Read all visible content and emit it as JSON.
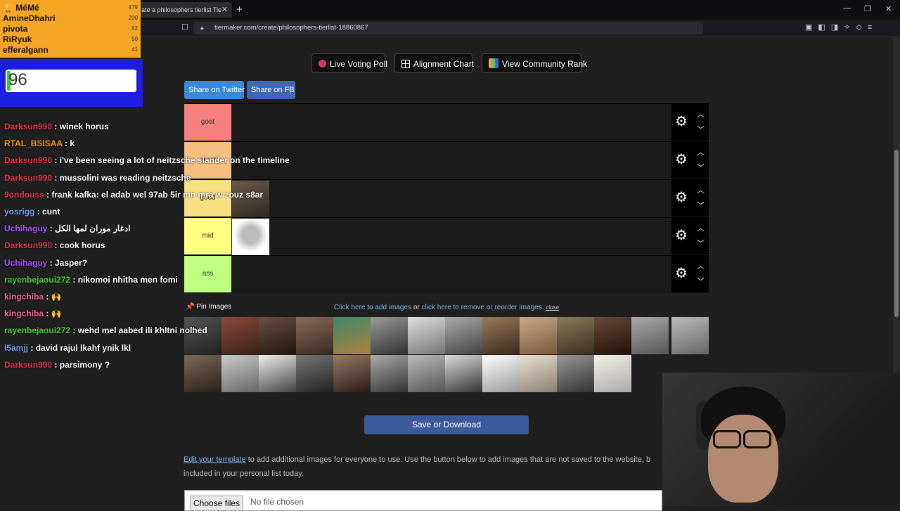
{
  "browser": {
    "tab_title": "ate a philosophers tierlist Tie",
    "tab_close": "✕",
    "new_tab": "+",
    "url": "tiermaker.com/create/philosophers-tierlist-18860867",
    "window_controls": [
      "—",
      "❐",
      "✕"
    ]
  },
  "toolbar": {
    "live_voting": "Live Voting Poll",
    "alignment_chart": "Alignment Chart",
    "community_rank": "View Community Rank",
    "share_twitter": "Share on Twitter",
    "share_fb": "Share on FB"
  },
  "tiers": [
    {
      "label": "goat",
      "color": "#f67f7f"
    },
    {
      "label": "great",
      "color": "#f7bf7f"
    },
    {
      "label": "good",
      "color": "#f7df7f"
    },
    {
      "label": "mid",
      "color": "#ffff80"
    },
    {
      "label": "ass",
      "color": "#bfff7f"
    }
  ],
  "pin": {
    "label": "Pin Images",
    "add_images": "Click here to add images",
    "or": " or ",
    "reorder": "click here to remove or reorder images.",
    "close": "close"
  },
  "save_button": "Save or Download",
  "edit": {
    "link": "Edit your template",
    "text": " to add additional images for everyone to use. Use the button below to add images that are not saved to the website, b",
    "text2": "included in your personal list today."
  },
  "file": {
    "button": "Choose files",
    "status": "No file chosen"
  },
  "leaderboard": [
    {
      "name": "🏆 MéMé",
      "score": "479"
    },
    {
      "name": "AmineDhahri",
      "score": "200"
    },
    {
      "name": "pivota",
      "score": "82"
    },
    {
      "name": "RiRyuk",
      "score": "50"
    },
    {
      "name": "efferalgann",
      "score": "41"
    }
  ],
  "counter": {
    "value": "96",
    "fill_fraction": 0.03
  },
  "chat": [
    {
      "user": "Darksun990",
      "msg": " : winek horus",
      "color": "#e0344b"
    },
    {
      "user": "RTAL_BSISAA",
      "msg": " : k",
      "color": "#f39c12"
    },
    {
      "user": "Darksun990",
      "msg": " : i've been seeing a lot of neitzsche slander on the timeline",
      "color": "#e0344b"
    },
    {
      "user": "Darksun990",
      "msg": " : mussolini was reading neitzsche",
      "color": "#e0344b"
    },
    {
      "user": "9ondouss",
      "msg": " : frank kafka: el adab wel 97ab 5ir mn mra w zouz s8ar",
      "color": "#e0344b"
    },
    {
      "user": "yosrigg",
      "msg": " : cunt",
      "color": "#6aa0f0"
    },
    {
      "user": "Uchihaguy",
      "msg": " : ادغار موران لمها الكل",
      "color": "#a855f7"
    },
    {
      "user": "Darksun990",
      "msg": " : cook horus",
      "color": "#e0344b"
    },
    {
      "user": "Uchihaguy",
      "msg": " : Jasper?",
      "color": "#a855f7"
    },
    {
      "user": "rayenbejaoui272",
      "msg": " : nikomoi nhitha men fomi",
      "color": "#4cd137"
    },
    {
      "user": "kingchiba",
      "msg": " : 🙌",
      "color": "#f06292"
    },
    {
      "user": "kingchiba",
      "msg": " : 🙌",
      "color": "#f06292"
    },
    {
      "user": "rayenbejaoui272",
      "msg": " : wehd mel aabed ili khltni nolhed",
      "color": "#4cd137"
    },
    {
      "user": "l5amjj",
      "msg": " : david rajul lkahf ynik lkl",
      "color": "#6aa0f0"
    },
    {
      "user": "Darksun990",
      "msg": " : parsimony ?",
      "color": "#e0344b"
    }
  ]
}
